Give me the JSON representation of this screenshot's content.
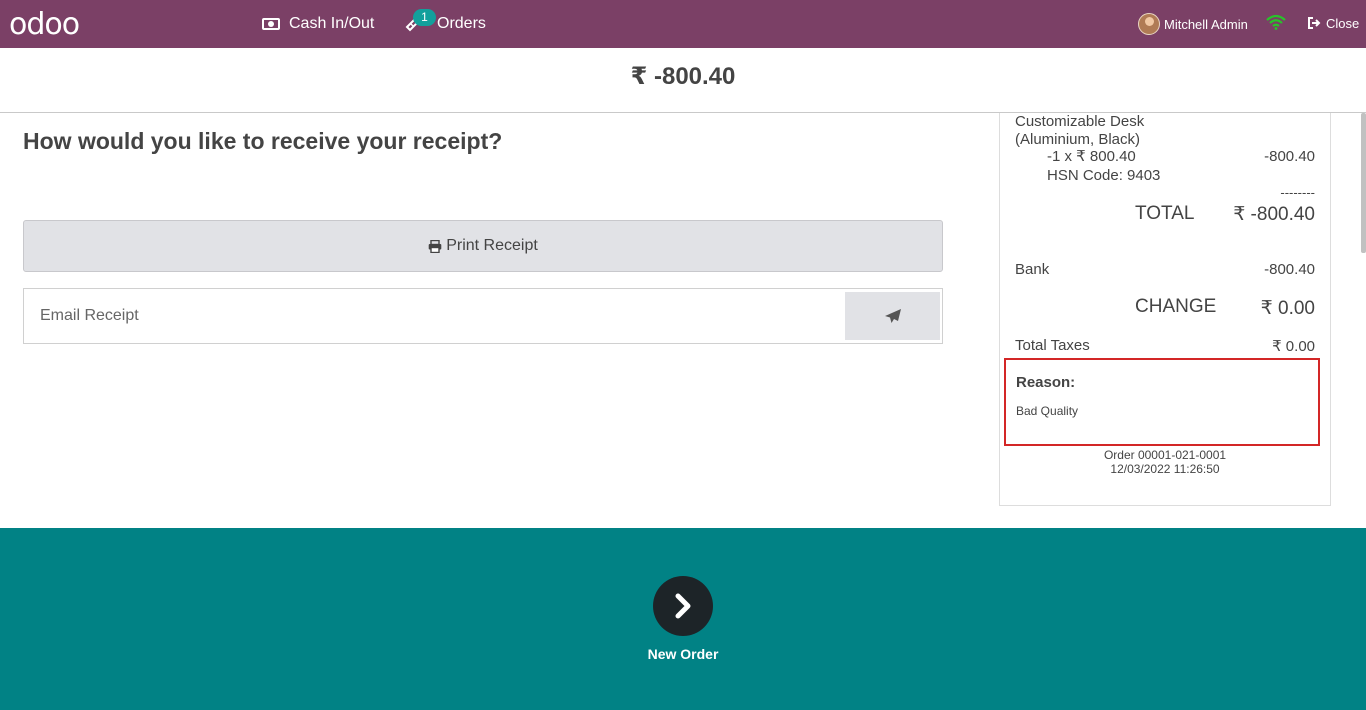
{
  "topbar": {
    "logo": "odoo",
    "cash_label": "Cash In/Out",
    "orders_label": "Orders",
    "orders_badge": "1",
    "user_name": "Mitchell Admin",
    "close_label": "Close"
  },
  "header": {
    "amount": "₹ -800.40"
  },
  "main": {
    "question": "How would you like to receive your receipt?",
    "print_label": "Print Receipt",
    "email_placeholder": "Email Receipt"
  },
  "receipt": {
    "product_line1": "Customizable Desk",
    "product_line2": "(Aluminium, Black)",
    "qty_price": "-1 x ₹ 800.40",
    "line_total": "-800.40",
    "hsn": "HSN Code: 9403",
    "divider": "--------",
    "total_label": "TOTAL",
    "total_value": "₹ -800.40",
    "payment_method": "Bank",
    "payment_value": "-800.40",
    "change_label": "CHANGE",
    "change_value": "₹ 0.00",
    "taxes_label": "Total Taxes",
    "taxes_value": "₹ 0.00",
    "reason_label": "Reason:",
    "reason_value": "Bad Quality",
    "order_ref": "Order 00001-021-0001",
    "order_date": "12/03/2022 11:26:50"
  },
  "footer": {
    "next_label": "New Order"
  },
  "colors": {
    "topbar": "#7b4066",
    "footer": "#018285",
    "badge": "#12a09c",
    "wifi": "#28c32a",
    "reason_border": "#d32626"
  },
  "icons": {
    "cash": "money-icon",
    "orders": "ticket-icon",
    "wifi": "wifi-icon",
    "close": "sign-out-icon",
    "print": "print-icon",
    "send": "paper-plane-icon",
    "next": "chevron-right-icon"
  }
}
